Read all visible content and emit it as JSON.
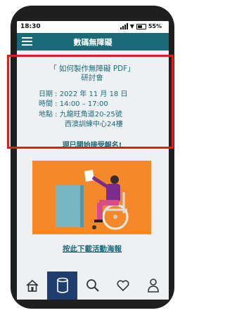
{
  "status": {
    "time": "18:30",
    "battery": "55%"
  },
  "appbar": {
    "title": "數碼無障礙"
  },
  "event": {
    "title_line1": "「 如何製作無障礙 PDF」",
    "title_line2": "研討會",
    "date_label": "日期 : 2022 年 11 月 18 日",
    "time_label": "時間 : 14:00 – 17:00",
    "venue_line1": "地點 : 九龍旺角道20-25號",
    "venue_line2": "西澳訓練中心24樓",
    "register_text": "現已開始接受報名!"
  },
  "poster": {
    "download_text": "按此下載活動海報"
  },
  "nav": {
    "items": [
      "home-icon",
      "library-icon",
      "search-icon",
      "heart-icon",
      "profile-icon"
    ],
    "active_index": 1
  },
  "colors": {
    "accent": "#1a6a78",
    "highlight": "#d8201f",
    "poster_bg": "#f5892a",
    "nav_active": "#1f3e6e"
  }
}
